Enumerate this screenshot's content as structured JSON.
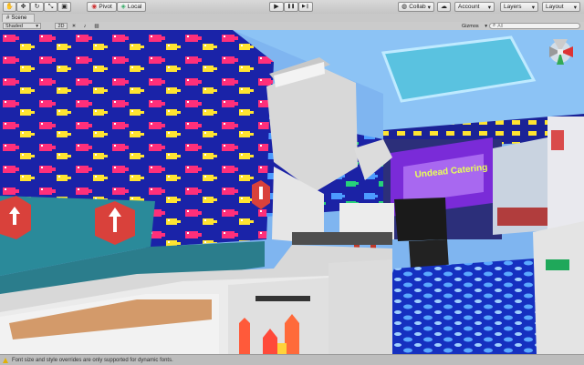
{
  "toolbar": {
    "tools": [
      {
        "name": "hand-tool-icon",
        "glyph": "✋"
      },
      {
        "name": "move-tool-icon",
        "glyph": "✥"
      },
      {
        "name": "rotate-tool-icon",
        "glyph": "↻"
      },
      {
        "name": "scale-tool-icon",
        "glyph": "⤡"
      },
      {
        "name": "rect-tool-icon",
        "glyph": "▣"
      }
    ],
    "pivot_label": "Pivot",
    "local_label": "Local",
    "play_glyph": "▶",
    "pause_glyph": "❚❚",
    "step_glyph": "▶❙",
    "collab_label": "Collab",
    "cloud_glyph": "☁",
    "account_label": "Account",
    "layers_label": "Layers",
    "layout_label": "Layout",
    "dropdown_glyph": "▾"
  },
  "tabbar": {
    "scene_tab_label": "Scene"
  },
  "scenebar": {
    "shaded_label": "Shaded",
    "mode_2d_label": "2D",
    "gizmos_label": "Gizmos",
    "search_placeholder": "All"
  },
  "viewport": {
    "sign_text": "Undead Catering"
  },
  "status": {
    "message": "Font size and style overrides are only supported for dynamic fonts."
  },
  "colors": {
    "fish_wall": "#1a23a8",
    "fish_colors": [
      "#ff2f7a",
      "#ffe431",
      "#4c9bff",
      "#ff8a1e",
      "#27d17a",
      "#b04bff",
      "#ff2f2f",
      "#9b1fe0",
      "#34cc44",
      "#f7f1ad"
    ],
    "sky": "#7fb5f0",
    "floor": "#1530c0",
    "counter": "#e4e4e4",
    "sign_bg": "#7a2bd8"
  }
}
